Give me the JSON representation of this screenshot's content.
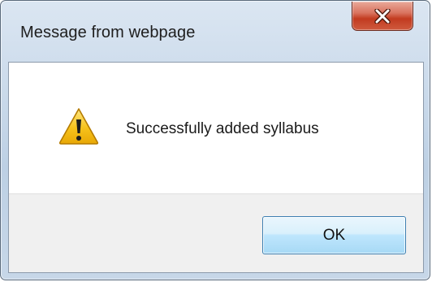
{
  "dialog": {
    "title": "Message from webpage",
    "message": "Successfully added syllabus",
    "ok_label": "OK",
    "close_glyph": "X",
    "icon": "warning-icon"
  },
  "colors": {
    "title_bar": "#c9d9ea",
    "close_button": "#c23b20",
    "ok_button": "#bee6fd",
    "ok_border": "#3c7fb1",
    "warning_yellow": "#f6c21b",
    "button_area": "#f0f0f0"
  }
}
